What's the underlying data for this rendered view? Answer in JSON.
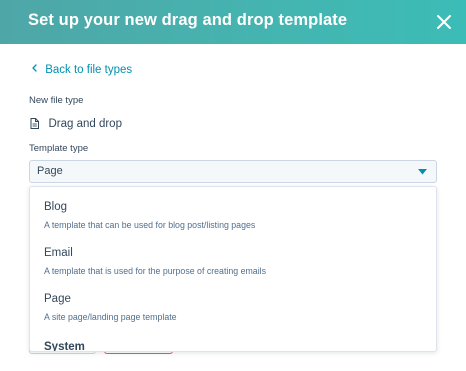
{
  "modal": {
    "title": "Set up your new drag and drop template"
  },
  "nav": {
    "back_label": "Back to file types"
  },
  "file_type": {
    "label": "New file type",
    "value": "Drag and drop"
  },
  "template_type": {
    "label": "Template type",
    "selected": "Page"
  },
  "options": [
    {
      "title": "Blog",
      "description": "A template that can be used for blog post/listing pages"
    },
    {
      "title": "Email",
      "description": "A template that is used for the purpose of creating emails"
    },
    {
      "title": "Page",
      "description": "A site page/landing page template"
    },
    {
      "title": "System",
      "description": ""
    }
  ],
  "icons": {
    "close": "close-icon",
    "back": "chevron-left-icon",
    "file": "document-icon",
    "caret": "caret-down-icon"
  },
  "colors": {
    "header_start": "#4fa6a7",
    "header_end": "#3cbcb6",
    "link": "#0091ae",
    "text": "#33475b",
    "muted": "#516f90",
    "danger_outline": "#f2545b"
  }
}
